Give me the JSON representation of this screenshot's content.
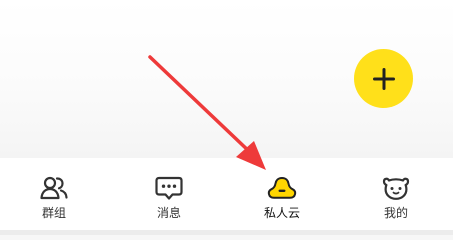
{
  "tabbar": {
    "active_index": 2,
    "items": [
      {
        "label": "群组",
        "icon": "group-icon"
      },
      {
        "label": "消息",
        "icon": "message-icon"
      },
      {
        "label": "私人云",
        "icon": "private-cloud-icon"
      },
      {
        "label": "我的",
        "icon": "profile-icon"
      }
    ]
  },
  "fab": {
    "icon": "plus-icon"
  },
  "annotation": {
    "icon": "red-arrow-icon",
    "color": "#ee3a3a"
  },
  "colors": {
    "accent": "#ffe01a",
    "icon_dark": "#333333",
    "arrow": "#ee3a3a"
  }
}
